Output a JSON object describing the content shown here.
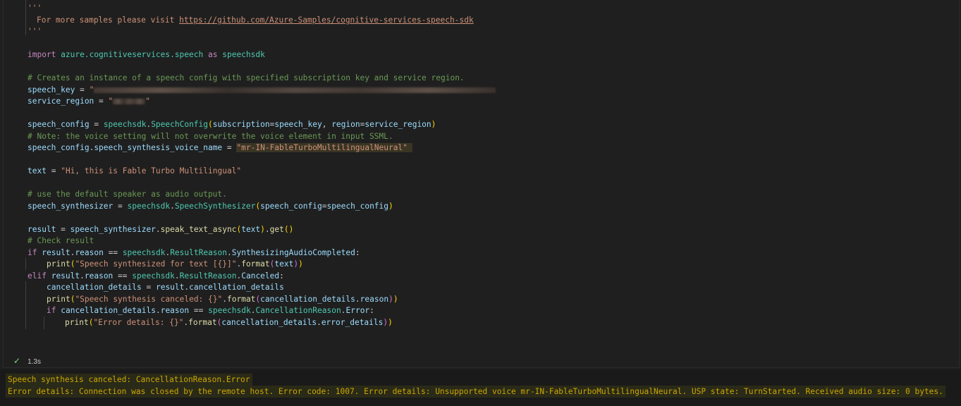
{
  "code": {
    "docstring_open": "'''",
    "docstring_text": "For more samples please visit ",
    "docstring_link": "https://github.com/Azure-Samples/cognitive-services-speech-sdk",
    "docstring_close": "'''",
    "import_kw": "import",
    "import_module": "azure.cognitiveservices.speech",
    "import_as": "as",
    "import_alias": "speechsdk",
    "comment_config": "# Creates an instance of a speech config with specified subscription key and service region.",
    "speech_key_var": "speech_key",
    "speech_key_value_redacted": "\"",
    "service_region_var": "service_region",
    "service_region_value_redacted": "\"",
    "speech_config_line": {
      "var": "speech_config",
      "mod": "speechsdk",
      "fn": "SpeechConfig",
      "arg1": "subscription",
      "val1": "speech_key",
      "arg2": "region",
      "val2": "service_region"
    },
    "comment_note": "# Note: the voice setting will not overwrite the voice element in input SSML.",
    "voice_line": {
      "var": "speech_config",
      "attr": "speech_synthesis_voice_name",
      "value": "\"mr-IN-FableTurboMultilingualNeural\""
    },
    "text_var": "text",
    "text_value": "\"Hi, this is Fable Turbo Multilingual\"",
    "comment_speaker": "# use the default speaker as audio output.",
    "synth_line": {
      "var": "speech_synthesizer",
      "mod": "speechsdk",
      "fn": "SpeechSynthesizer",
      "arg": "speech_config",
      "val": "speech_config"
    },
    "result_line": {
      "var": "result",
      "obj": "speech_synthesizer",
      "fn1": "speak_text_async",
      "arg": "text",
      "fn2": "get"
    },
    "comment_check": "# Check result",
    "if_line": {
      "kw": "if",
      "obj": "result",
      "attr": "reason",
      "mod": "speechsdk",
      "cls": "ResultReason",
      "member": "SynthesizingAudioCompleted"
    },
    "print1": {
      "fn": "print",
      "str": "\"Speech synthesized for text [{}]\"",
      "method": "format",
      "arg": "text"
    },
    "elif_line": {
      "kw": "elif",
      "obj": "result",
      "attr": "reason",
      "mod": "speechsdk",
      "cls": "ResultReason",
      "member": "Canceled"
    },
    "cancel_line": {
      "var": "cancellation_details",
      "obj": "result",
      "attr": "cancellation_details"
    },
    "print2": {
      "fn": "print",
      "str": "\"Speech synthesis canceled: {}\"",
      "method": "format",
      "obj": "cancellation_details",
      "attr": "reason"
    },
    "if2_line": {
      "kw": "if",
      "obj": "cancellation_details",
      "attr": "reason",
      "mod": "speechsdk",
      "cls": "CancellationReason",
      "member": "Error"
    },
    "print3": {
      "fn": "print",
      "str": "\"Error details: {}\"",
      "method": "format",
      "obj": "cancellation_details",
      "attr": "error_details"
    }
  },
  "status": {
    "icon": "check-icon",
    "duration": "1.3s",
    "success_color": "#89d185"
  },
  "output": {
    "line1": "Speech synthesis canceled: CancellationReason.Error",
    "line2": "Error details: Connection was closed by the remote host. Error code: 1007. Error details: Unsupported voice mr-IN-FableTurboMultilingualNeural. USP state: TurnStarted. Received audio size: 0 bytes.",
    "warning_color": "#cca700"
  }
}
